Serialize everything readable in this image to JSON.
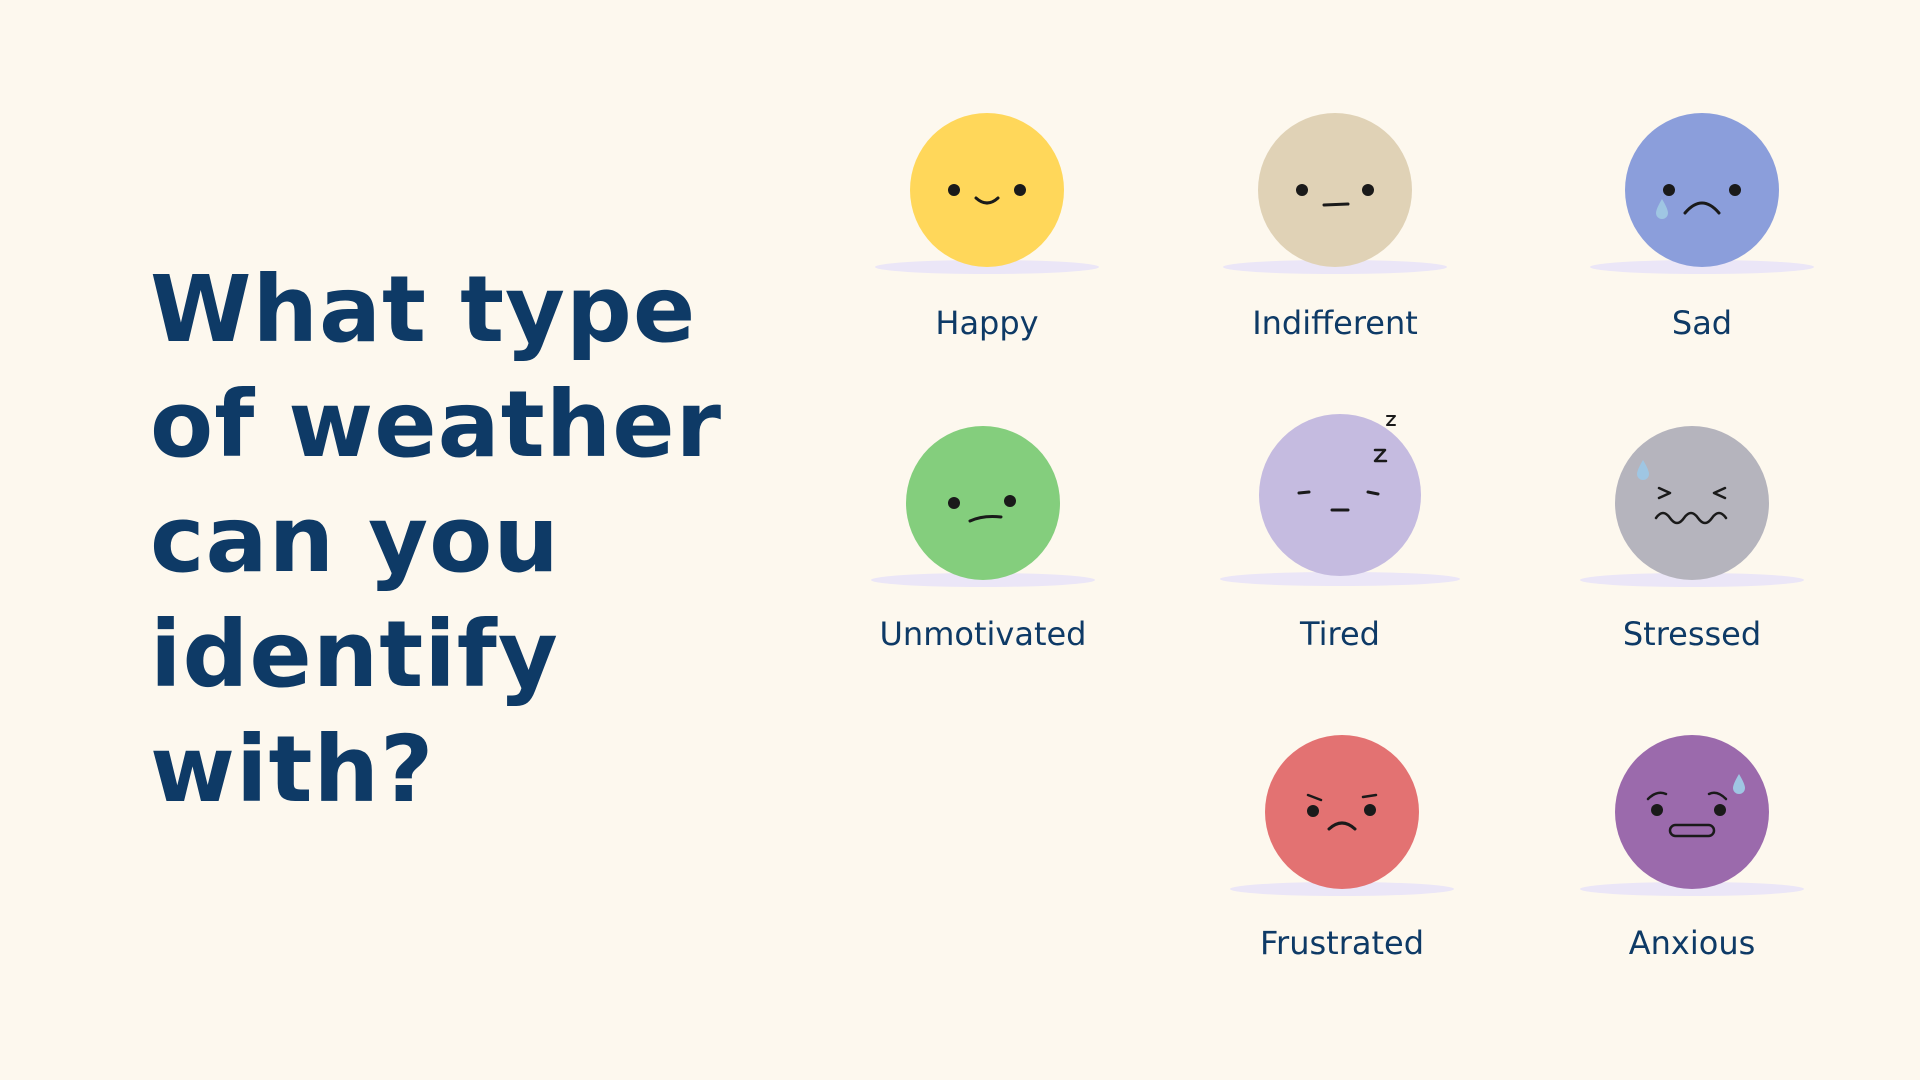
{
  "question": {
    "lines": [
      "What type",
      "of weather",
      "can you",
      "identify",
      "with?"
    ]
  },
  "colors": {
    "background": "#fdf8ee",
    "text": "#0e3a66",
    "shadow": "#ebe6f7",
    "face_features": "#1a1a1a",
    "tear": "#9fc6e3"
  },
  "moods": [
    {
      "label": "Happy",
      "color": "#ffd75a",
      "icon": "happy-face-icon"
    },
    {
      "label": "Indifferent",
      "color": "#e0d2b6",
      "icon": "indifferent-face-icon"
    },
    {
      "label": "Sad",
      "color": "#8b9edb",
      "icon": "sad-face-icon"
    },
    {
      "label": "Unmotivated",
      "color": "#84ce7d",
      "icon": "unmotivated-face-icon"
    },
    {
      "label": "Tired",
      "color": "#c5bbe0",
      "icon": "tired-face-icon"
    },
    {
      "label": "Stressed",
      "color": "#b5b4bd",
      "icon": "stressed-face-icon"
    },
    {
      "label": "Frustrated",
      "color": "#e37272",
      "icon": "frustrated-face-icon"
    },
    {
      "label": "Anxious",
      "color": "#9b6aac",
      "icon": "anxious-face-icon"
    }
  ]
}
